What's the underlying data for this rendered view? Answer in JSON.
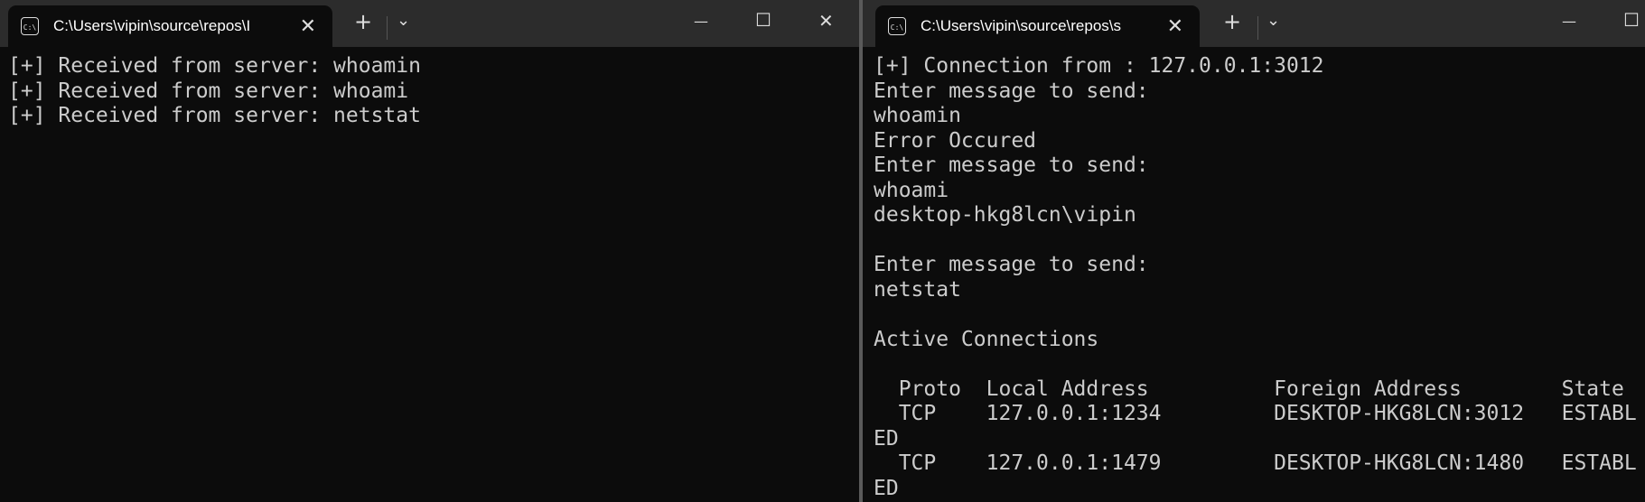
{
  "left_window": {
    "tab_title": "C:\\Users\\vipin\\source\\repos\\I",
    "tab_icon": "cmd-icon",
    "controls": {
      "new_tab": "+",
      "dropdown": "⌄",
      "minimize": "—",
      "maximize": "☐",
      "close": "✕"
    },
    "lines": [
      "[+] Received from server: whoamin",
      "[+] Received from server: whoami",
      "[+] Received from server: netstat"
    ]
  },
  "right_window": {
    "tab_title": "C:\\Users\\vipin\\source\\repos\\s",
    "tab_icon": "cmd-icon",
    "controls": {
      "new_tab": "+",
      "dropdown": "⌄",
      "minimize": "—",
      "maximize": "☐"
    },
    "lines": [
      "[+] Connection from : 127.0.0.1:3012",
      "Enter message to send:",
      "whoamin",
      "Error Occured",
      "Enter message to send:",
      "whoami",
      "desktop-hkg8lcn\\vipin",
      "",
      "Enter message to send:",
      "netstat",
      "",
      "Active Connections",
      "",
      "  Proto  Local Address          Foreign Address        State",
      "  TCP    127.0.0.1:1234         DESKTOP-HKG8LCN:3012   ESTABL",
      "ED",
      "  TCP    127.0.0.1:1479         DESKTOP-HKG8LCN:1480   ESTABL",
      "ED"
    ]
  }
}
